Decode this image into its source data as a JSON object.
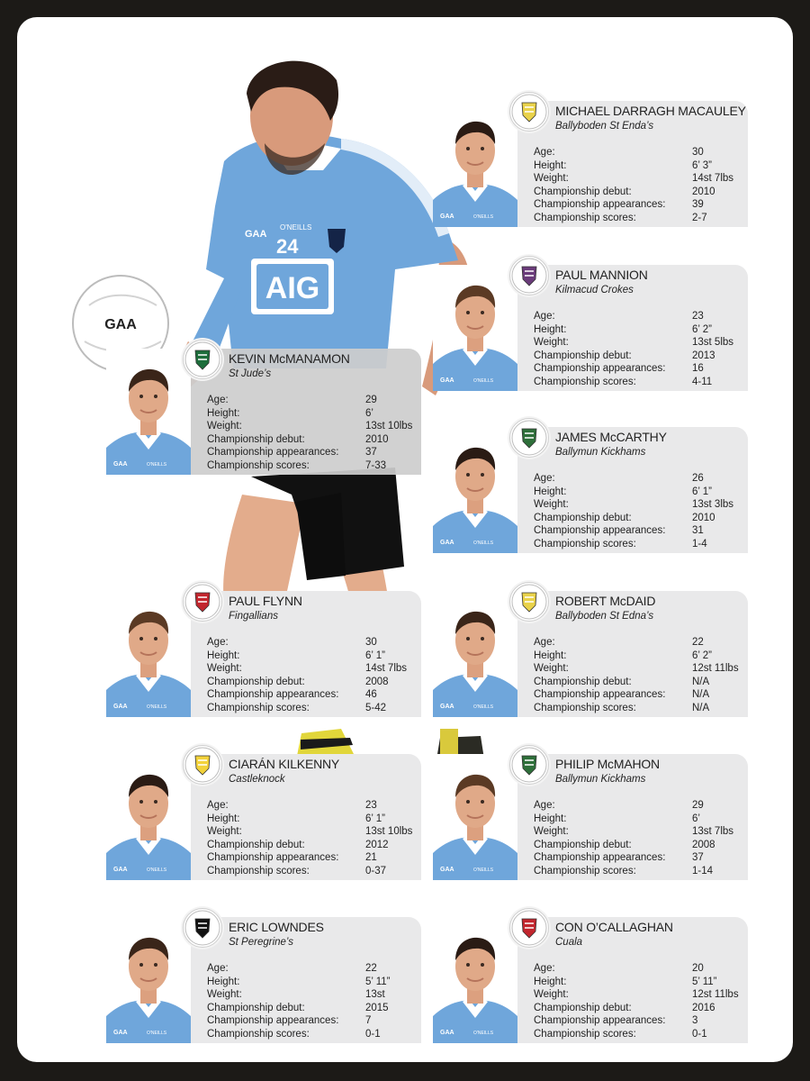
{
  "hero": {
    "jersey_sponsor": "AIG",
    "jersey_number": "24",
    "kit_brand": "O'NEILLS",
    "ball_logo": "GAA",
    "assoc_logo": "GAA"
  },
  "stat_labels": [
    "Age:",
    "Height:",
    "Weight:",
    "Championship debut:",
    "Championship appearances:",
    "Championship scores:"
  ],
  "players": [
    {
      "name": "MICHAEL DARRAGH MACAULEY",
      "club": "Ballyboden St Enda’s",
      "age": "30",
      "height": "6’ 3”",
      "weight": "14st 7lbs",
      "debut": "2010",
      "appearances": "39",
      "scores": "2-7"
    },
    {
      "name": "PAUL MANNION",
      "club": "Kilmacud Crokes",
      "age": "23",
      "height": "6’ 2”",
      "weight": "13st 5lbs",
      "debut": "2013",
      "appearances": "16",
      "scores": "4-11"
    },
    {
      "name": "KEVIN McMANAMON",
      "club": "St Jude’s",
      "age": "29",
      "height": "6’",
      "weight": "13st 10lbs",
      "debut": "2010",
      "appearances": "37",
      "scores": "7-33"
    },
    {
      "name": "JAMES McCARTHY",
      "club": "Ballymun Kickhams",
      "age": "26",
      "height": "6’ 1”",
      "weight": "13st 3lbs",
      "debut": "2010",
      "appearances": "31",
      "scores": "1-4"
    },
    {
      "name": "PAUL FLYNN",
      "club": "Fingallians",
      "age": "30",
      "height": "6’ 1”",
      "weight": "14st 7lbs",
      "debut": "2008",
      "appearances": "46",
      "scores": "5-42"
    },
    {
      "name": "ROBERT McDAID",
      "club": "Ballyboden St Edna’s",
      "age": "22",
      "height": "6’ 2”",
      "weight": "12st 11lbs",
      "debut": "N/A",
      "appearances": "N/A",
      "scores": "N/A"
    },
    {
      "name": "CIARÁN KILKENNY",
      "club": "Castleknock",
      "age": "23",
      "height": "6’ 1”",
      "weight": "13st 10lbs",
      "debut": "2012",
      "appearances": "21",
      "scores": "0-37"
    },
    {
      "name": "PHILIP McMAHON",
      "club": "Ballymun Kickhams",
      "age": "29",
      "height": "6’",
      "weight": "13st 7lbs",
      "debut": "2008",
      "appearances": "37",
      "scores": "1-14"
    },
    {
      "name": "ERIC LOWNDES",
      "club": "St Peregrine’s",
      "age": "22",
      "height": "5’ 11”",
      "weight": "13st",
      "debut": "2015",
      "appearances": "7",
      "scores": "0-1"
    },
    {
      "name": "CON O’CALLAGHAN",
      "club": "Cuala",
      "age": "20",
      "height": "5’ 11”",
      "weight": "12st 11lbs",
      "debut": "2016",
      "appearances": "3",
      "scores": "0-1"
    }
  ],
  "colors": {
    "jersey": "#6fa6db",
    "navy": "#142447",
    "panel": "#e9e9ea"
  }
}
